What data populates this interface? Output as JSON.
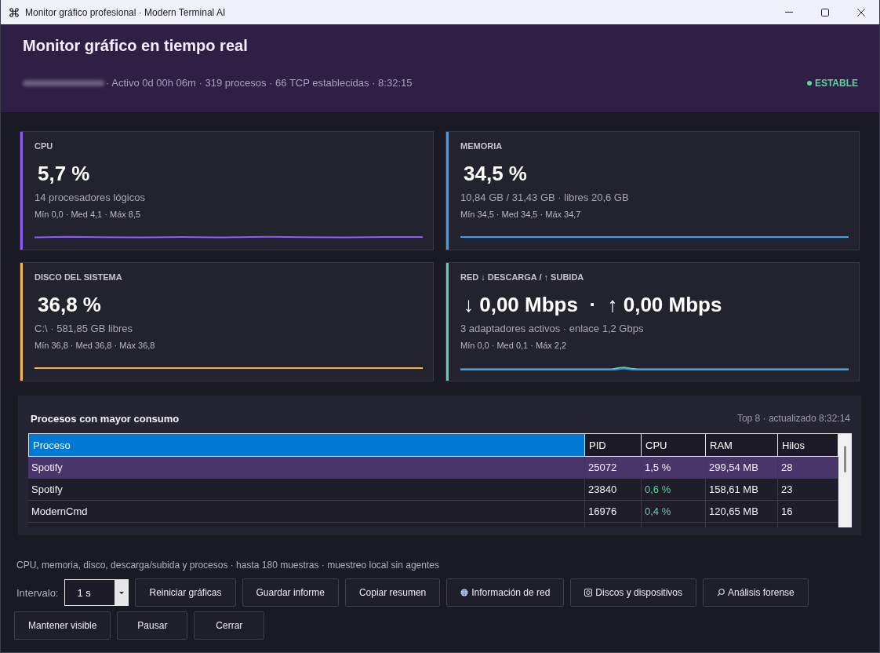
{
  "window": {
    "title": "Monitor gráfico profesional · Modern Terminal AI"
  },
  "header": {
    "title": "Monitor gráfico en tiempo real",
    "host_blurred": true,
    "status_line": "· Activo 0d 00h 06m · 319 procesos · 66 TCP establecidas · 8:32:15",
    "status": {
      "label": "ESTABLE",
      "color": "#5fd3a0"
    }
  },
  "cards": [
    {
      "label": "CPU",
      "value": "5,7 %",
      "detail": "14 procesadores lógicos",
      "range": "Mín 0,0 · Med 4,1 · Máx 8,5",
      "color": "#8b5cf6"
    },
    {
      "label": "MEMORIA",
      "value": "34,5 %",
      "detail": "10,84 GB / 31,43 GB · libres 20,6 GB",
      "range": "Mín 34,5 · Med 34,5 · Máx 34,7",
      "color": "#3ba3ec"
    },
    {
      "label": "DISCO DEL SISTEMA",
      "value": "36,8 %",
      "detail": "C:\\ · 581,85 GB libres",
      "range": "Mín 36,8 · Med 36,8 · Máx 36,8",
      "color": "#f5b94a"
    },
    {
      "label": "RED ↓ DESCARGA / ↑ SUBIDA",
      "value": "↓ 0,00 Mbps  ·  ↑ 0,00 Mbps",
      "detail": "3 adaptadores activos · enlace 1,2 Gbps",
      "range": "Mín 0,0 · Med 0,1 · Máx 2,2",
      "color": "#5fd3a0"
    }
  ],
  "processes": {
    "title": "Procesos con mayor consumo",
    "meta": "Top 8 · actualizado 8:32:14",
    "columns": [
      {
        "label": "Proceso",
        "selected": true
      },
      {
        "label": "PID",
        "selected": false
      },
      {
        "label": "CPU",
        "selected": false
      },
      {
        "label": "RAM",
        "selected": false
      },
      {
        "label": "Hilos",
        "selected": false
      }
    ],
    "rows": [
      {
        "cells": [
          "Spotify",
          "25072",
          "1,5 %",
          "299,54 MB",
          "28"
        ],
        "selected": true
      },
      {
        "cells": [
          "Spotify",
          "23840",
          "0,6 %",
          "158,61 MB",
          "23"
        ],
        "selected": false,
        "color": "#5fd3a0"
      },
      {
        "cells": [
          "ModernCmd",
          "16976",
          "0,4 %",
          "120,65 MB",
          "16"
        ],
        "selected": false,
        "color": "#5fd3a0"
      }
    ]
  },
  "footer": {
    "note": "CPU, memoria, disco, descarga/subida y procesos · hasta 180 muestras · muestreo local sin agentes",
    "interval": {
      "label": "Intervalo:",
      "value": "1 s"
    },
    "buttons": [
      {
        "label": "Reiniciar gráficas",
        "kind": "text"
      },
      {
        "label": "Guardar informe",
        "kind": "text"
      },
      {
        "label": "Copiar resumen",
        "kind": "text"
      },
      {
        "label": "Información de red",
        "kind": "globe"
      },
      {
        "label": "Discos y dispositivos",
        "kind": "disk"
      },
      {
        "label": "Análisis forense",
        "kind": "search"
      },
      {
        "label": "Mantener visible",
        "kind": "text"
      },
      {
        "label": "Pausar",
        "kind": "text"
      },
      {
        "label": "Cerrar",
        "kind": "text"
      }
    ]
  }
}
